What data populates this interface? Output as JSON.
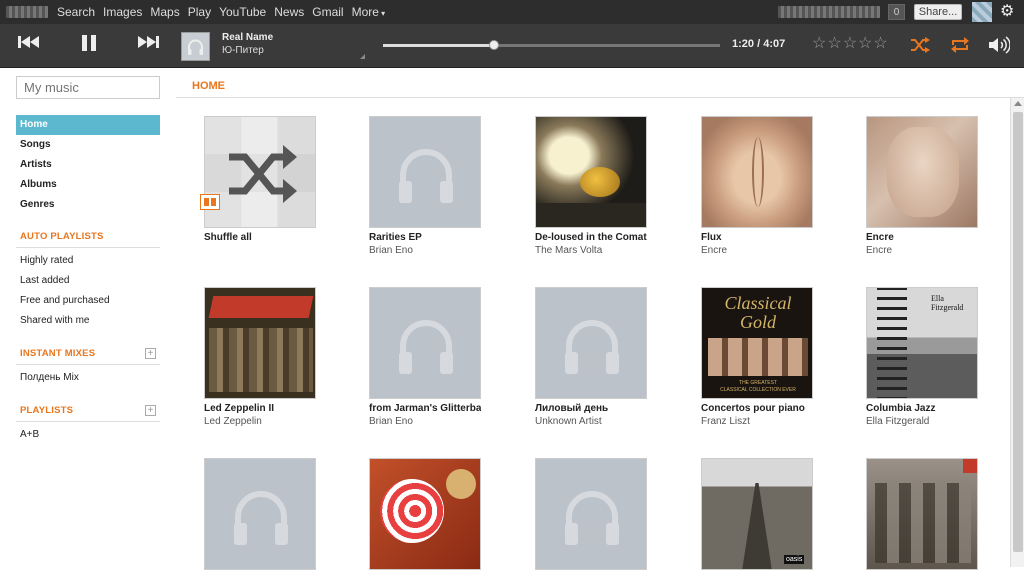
{
  "topbar": {
    "nav": [
      "Search",
      "Images",
      "Maps",
      "Play",
      "YouTube",
      "News",
      "Gmail",
      "More"
    ],
    "count": "0",
    "share_label": "Share..."
  },
  "player": {
    "track_title": "Real Name",
    "track_artist": "Ю-Питер",
    "time_current": "1:20",
    "time_separator": "/",
    "time_total": "4:07",
    "progress_fraction": 0.33,
    "rating": 0,
    "rating_max": 5,
    "accent_color": "#e8761e"
  },
  "sidebar": {
    "search_placeholder": "My music",
    "main_items": [
      "Home",
      "Songs",
      "Artists",
      "Albums",
      "Genres"
    ],
    "auto_playlists_head": "AUTO PLAYLISTS",
    "auto_playlists": [
      "Highly rated",
      "Last added",
      "Free and purchased",
      "Shared with me"
    ],
    "instant_mixes_head": "INSTANT MIXES",
    "instant_mixes": [
      "Полдень Mix"
    ],
    "playlists_head": "PLAYLISTS",
    "playlists": [
      "A+B"
    ],
    "active_color": "#5bb8cf"
  },
  "main": {
    "heading": "HOME",
    "tiles": [
      {
        "name": "Shuffle all",
        "artist": "",
        "art": "shuffle"
      },
      {
        "name": "Rarities EP",
        "artist": "Brian Eno",
        "art": "placeholder"
      },
      {
        "name": "De-loused in the Comatorium",
        "artist": "The Mars Volta",
        "art": "deloused"
      },
      {
        "name": "Flux",
        "artist": "Encre",
        "art": "flux"
      },
      {
        "name": "Encre",
        "artist": "Encre",
        "art": "encre"
      },
      {
        "name": "Led Zeppelin II",
        "artist": "Led Zeppelin",
        "art": "zeppelin"
      },
      {
        "name": "from Jarman's Glitterball",
        "artist": "Brian Eno",
        "art": "placeholder"
      },
      {
        "name": "Лиловый день",
        "artist": "Unknown Artist",
        "art": "placeholder"
      },
      {
        "name": "Concertos pour piano",
        "artist": "Franz Liszt",
        "art": "classical",
        "art_text": [
          "Classical",
          "Gold",
          "THE GREATEST",
          "CLASSICAL COLLECTION EVER"
        ]
      },
      {
        "name": "Columbia Jazz",
        "artist": "Ella Fitzgerald",
        "art": "ella",
        "art_text": [
          "Ella",
          "Fitzgerald"
        ]
      },
      {
        "name": "",
        "artist": "",
        "art": "placeholder"
      },
      {
        "name": "",
        "artist": "",
        "art": "rust"
      },
      {
        "name": "",
        "artist": "",
        "art": "placeholder"
      },
      {
        "name": "",
        "artist": "",
        "art": "oasis",
        "art_text": [
          "oasis"
        ]
      },
      {
        "name": "",
        "artist": "",
        "art": "queen"
      }
    ]
  }
}
